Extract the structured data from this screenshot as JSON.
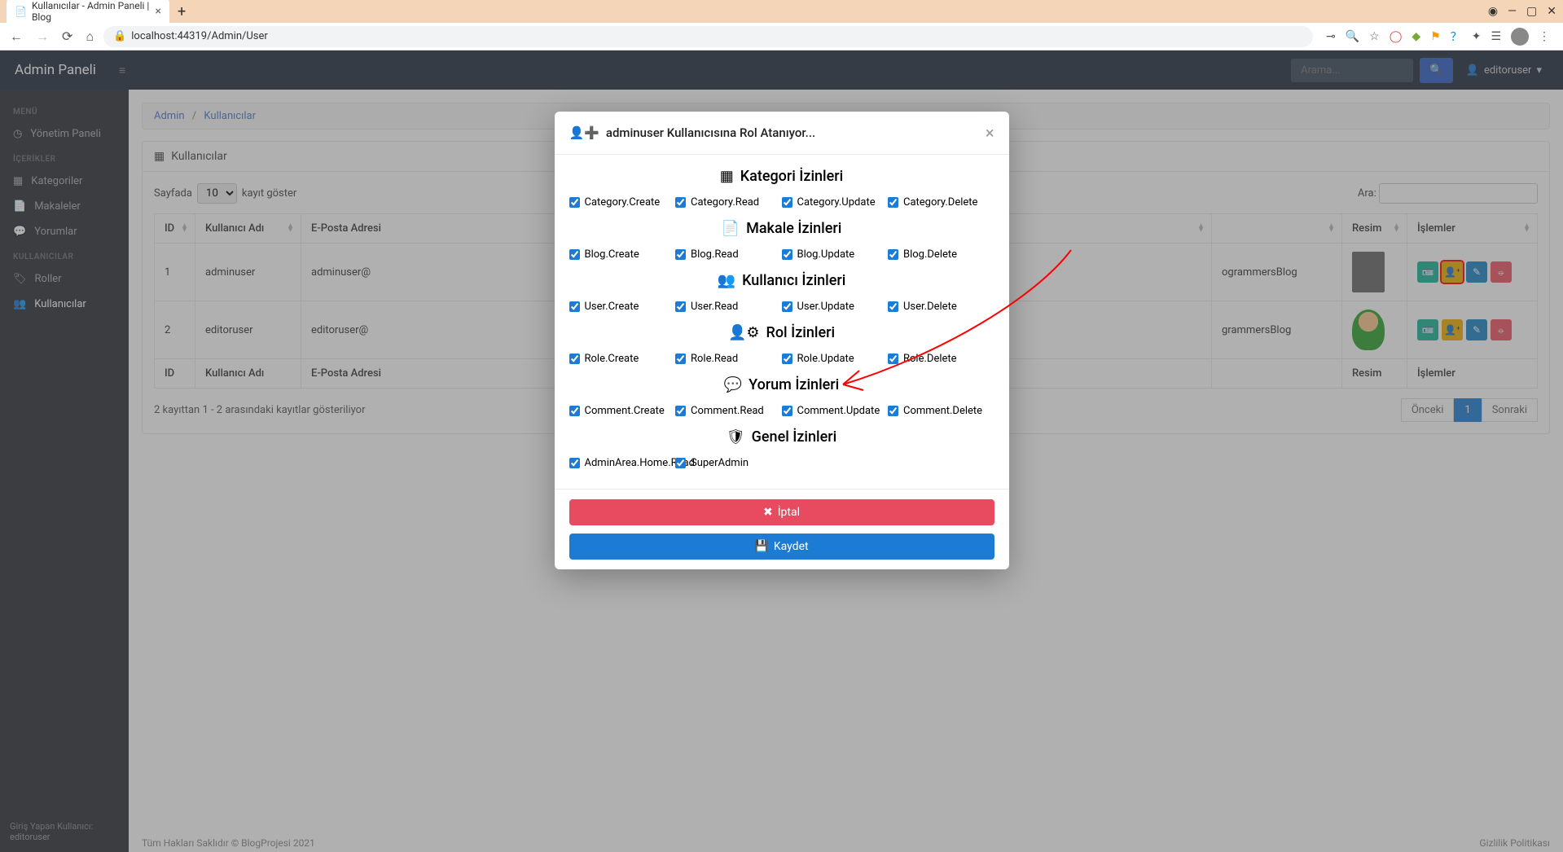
{
  "browser": {
    "tab_title": "Kullanıcılar - Admin Paneli | Blog",
    "url": "localhost:44319/Admin/User",
    "url_port": "44319"
  },
  "topbar": {
    "brand": "Admin Paneli",
    "search_placeholder": "Arama...",
    "user": "editoruser"
  },
  "sidebar": {
    "menu_heading": "MENÜ",
    "items_menu": [
      {
        "label": "Yönetim Paneli"
      }
    ],
    "content_heading": "İÇERİKLER",
    "items_content": [
      {
        "label": "Kategoriler"
      },
      {
        "label": "Makaleler"
      },
      {
        "label": "Yorumlar"
      }
    ],
    "users_heading": "KULLANICILAR",
    "items_users": [
      {
        "label": "Roller"
      },
      {
        "label": "Kullanıcılar"
      }
    ],
    "footer_label": "Giriş Yapan Kullanıcı:",
    "footer_user": "editoruser"
  },
  "breadcrumb": {
    "root": "Admin",
    "current": "Kullanıcılar"
  },
  "card": {
    "title": "Kullanıcılar"
  },
  "table": {
    "length_prefix": "Sayfada",
    "length_value": "10",
    "length_suffix": "kayıt göster",
    "filter_label": "Ara:",
    "columns": [
      "ID",
      "Kullanıcı Adı",
      "E-Posta Adresi",
      "",
      "Resim",
      "İşlemler"
    ],
    "rows": [
      {
        "id": "1",
        "username": "adminuser",
        "email_prefix": "adminuser@",
        "desc_suffix": "ogrammersBlog"
      },
      {
        "id": "2",
        "username": "editoruser",
        "email_prefix": "editoruser@",
        "desc_suffix": "grammersBlog"
      }
    ],
    "footer_columns": [
      "ID",
      "Kullanıcı Adı",
      "E-Posta Adresi",
      "",
      "Resim",
      "İşlemler"
    ],
    "info": "2 kayıttan 1 - 2 arasındaki kayıtlar gösteriliyor",
    "prev": "Önceki",
    "page": "1",
    "next": "Sonraki"
  },
  "footer": {
    "copyright": "Tüm Hakları Saklıdır © BlogProjesi 2021",
    "privacy": "Gizlilik Politikası"
  },
  "modal": {
    "title": "adminuser Kullanıcısına Rol Atanıyor...",
    "sections": [
      {
        "title": "Kategori İzinleri",
        "icon": "th",
        "perms": [
          "Category.Create",
          "Category.Read",
          "Category.Update",
          "Category.Delete"
        ]
      },
      {
        "title": "Makale İzinleri",
        "icon": "file",
        "perms": [
          "Blog.Create",
          "Blog.Read",
          "Blog.Update",
          "Blog.Delete"
        ]
      },
      {
        "title": "Kullanıcı İzinleri",
        "icon": "users",
        "perms": [
          "User.Create",
          "User.Read",
          "User.Update",
          "User.Delete"
        ]
      },
      {
        "title": "Rol İzinleri",
        "icon": "user-cog",
        "perms": [
          "Role.Create",
          "Role.Read",
          "Role.Update",
          "Role.Delete"
        ]
      },
      {
        "title": "Yorum İzinleri",
        "icon": "comments",
        "perms": [
          "Comment.Create",
          "Comment.Read",
          "Comment.Update",
          "Comment.Delete"
        ]
      },
      {
        "title": "Genel İzinleri",
        "icon": "shield",
        "perms": [
          "AdminArea.Home.Read",
          "SuperAdmin"
        ]
      }
    ],
    "cancel": "İptal",
    "save": "Kaydet"
  }
}
